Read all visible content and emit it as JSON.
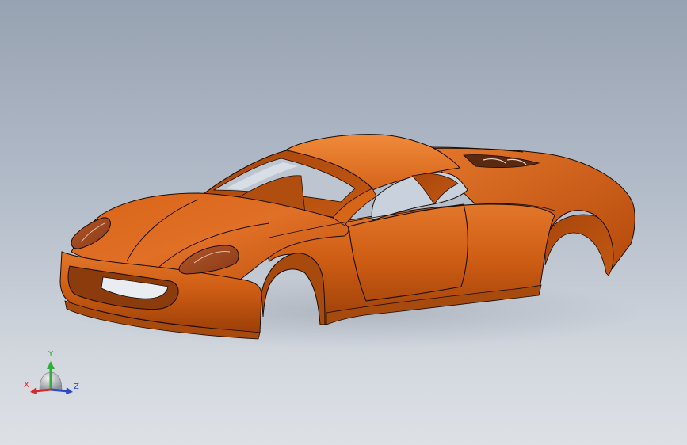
{
  "triad": {
    "x_label": "X",
    "y_label": "Y",
    "z_label": "Z",
    "x_color": "#d42a2a",
    "y_color": "#2fae3a",
    "z_color": "#2a48c8"
  },
  "model": {
    "body_color": "#c5560f",
    "edge_color": "#1a0c05"
  }
}
